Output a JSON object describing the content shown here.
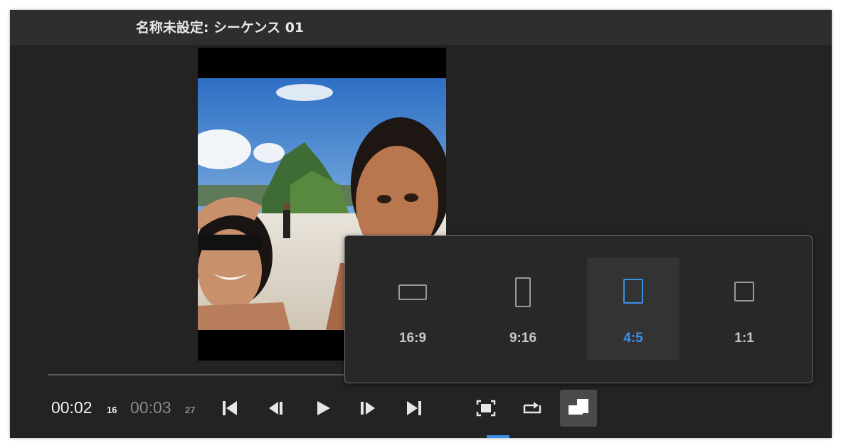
{
  "window": {
    "title": "名称未設定: シーケンス 01"
  },
  "playback": {
    "current_time": "00:02",
    "current_frames": "16",
    "duration_time": "00:03",
    "duration_frames": "27"
  },
  "controls": [
    {
      "name": "go-to-in-point",
      "icon": "step-to-start-icon"
    },
    {
      "name": "step-back",
      "icon": "step-back-icon"
    },
    {
      "name": "play",
      "icon": "play-icon"
    },
    {
      "name": "step-forward",
      "icon": "step-forward-icon"
    },
    {
      "name": "go-to-out-point",
      "icon": "step-to-end-icon"
    },
    {
      "name": "fit-frame",
      "icon": "fit-frame-icon"
    },
    {
      "name": "loop",
      "icon": "loop-icon"
    },
    {
      "name": "aspect-ratio",
      "icon": "aspect-ratio-icon",
      "active": true
    }
  ],
  "aspect_popover": {
    "options": [
      {
        "label": "16:9",
        "icon": "landscape-frame-icon"
      },
      {
        "label": "9:16",
        "icon": "portrait-frame-icon"
      },
      {
        "label": "4:5",
        "icon": "vertical-frame-icon",
        "selected": true
      },
      {
        "label": "1:1",
        "icon": "square-frame-icon"
      }
    ]
  },
  "colors": {
    "accent": "#3c8fe6",
    "panel": "#232323",
    "titlebar": "#2e2e2e"
  }
}
